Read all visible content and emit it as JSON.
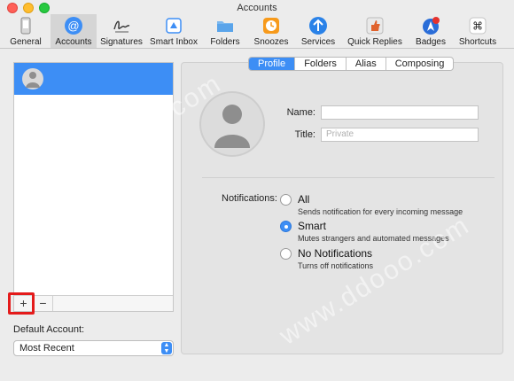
{
  "window": {
    "title": "Accounts"
  },
  "toolbar": {
    "items": [
      {
        "label": "General",
        "icon": "phone-icon"
      },
      {
        "label": "Accounts",
        "icon": "at-sign-icon",
        "selected": true
      },
      {
        "label": "Signatures",
        "icon": "signature-icon"
      },
      {
        "label": "Smart Inbox",
        "icon": "smart-inbox-icon"
      },
      {
        "label": "Folders",
        "icon": "folder-icon"
      },
      {
        "label": "Snoozes",
        "icon": "clock-icon"
      },
      {
        "label": "Services",
        "icon": "arrow-up-icon"
      },
      {
        "label": "Quick Replies",
        "icon": "thumbs-up-icon"
      },
      {
        "label": "Badges",
        "icon": "badge-icon"
      },
      {
        "label": "Shortcuts",
        "icon": "command-icon"
      }
    ]
  },
  "accounts_list": {
    "add_label": "+",
    "remove_label": "−"
  },
  "default_account": {
    "label": "Default Account:",
    "value": "Most Recent"
  },
  "tabs": [
    "Profile",
    "Folders",
    "Alias",
    "Composing"
  ],
  "active_tab": "Profile",
  "profile": {
    "name_label": "Name:",
    "name_value": "",
    "title_label": "Title:",
    "title_placeholder": "Private"
  },
  "notifications": {
    "label": "Notifications:",
    "options": [
      {
        "title": "All",
        "desc": "Sends notification for every incoming message",
        "selected": false
      },
      {
        "title": "Smart",
        "desc": "Mutes strangers and automated messages",
        "selected": true
      },
      {
        "title": "No Notifications",
        "desc": "Turns off notifications",
        "selected": false
      }
    ]
  },
  "colors": {
    "accent": "#3d8ef5",
    "highlight": "#e41b1b"
  },
  "watermark": "www.ddooo.com"
}
